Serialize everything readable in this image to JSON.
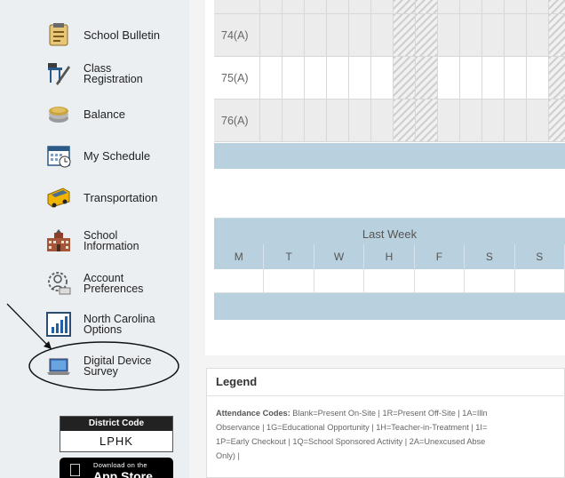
{
  "sidebar": {
    "items": [
      {
        "line1": "School Bulletin",
        "line2": "",
        "icon": "bulletin-icon"
      },
      {
        "line1": "Class",
        "line2": "Registration",
        "icon": "class-registration-icon"
      },
      {
        "line1": "Balance",
        "line2": "",
        "icon": "coins-icon"
      },
      {
        "line1": "My Schedule",
        "line2": "",
        "icon": "calendar-icon"
      },
      {
        "line1": "Transportation",
        "line2": "",
        "icon": "school-bus-icon"
      },
      {
        "line1": "School",
        "line2": "Information",
        "icon": "school-building-icon"
      },
      {
        "line1": "Account",
        "line2": "Preferences",
        "icon": "account-gear-icon"
      },
      {
        "line1": "North Carolina",
        "line2": "Options",
        "icon": "chart-icon"
      },
      {
        "line1": "Digital Device",
        "line2": "Survey",
        "icon": "laptop-icon"
      }
    ],
    "district": {
      "title": "District Code",
      "code": "LPHK"
    },
    "appstore": {
      "small": "Download on the",
      "big": "App Store"
    }
  },
  "attendance": {
    "rows": [
      {
        "label": "74(A)"
      },
      {
        "label": "75(A)"
      },
      {
        "label": "76(A)"
      }
    ]
  },
  "last_week": {
    "title": "Last Week",
    "days": [
      "M",
      "T",
      "W",
      "H",
      "F",
      "S",
      "S"
    ]
  },
  "legend": {
    "title": "Legend",
    "codes_label": "Attendance Codes:",
    "line1": "Blank=Present On-Site | 1R=Present Off-Site | 1A=Illn",
    "line2": "Observance | 1G=Educational Opportunity | 1H=Teacher-in-Treatment | 1I=",
    "line3": "1P=Early Checkout | 1Q=School Sponsored Activity | 2A=Unexcused Abse",
    "line4": "Only) |"
  },
  "colors": {
    "header_blue": "#b9d0de",
    "sidebar_bg": "#eceff2"
  }
}
